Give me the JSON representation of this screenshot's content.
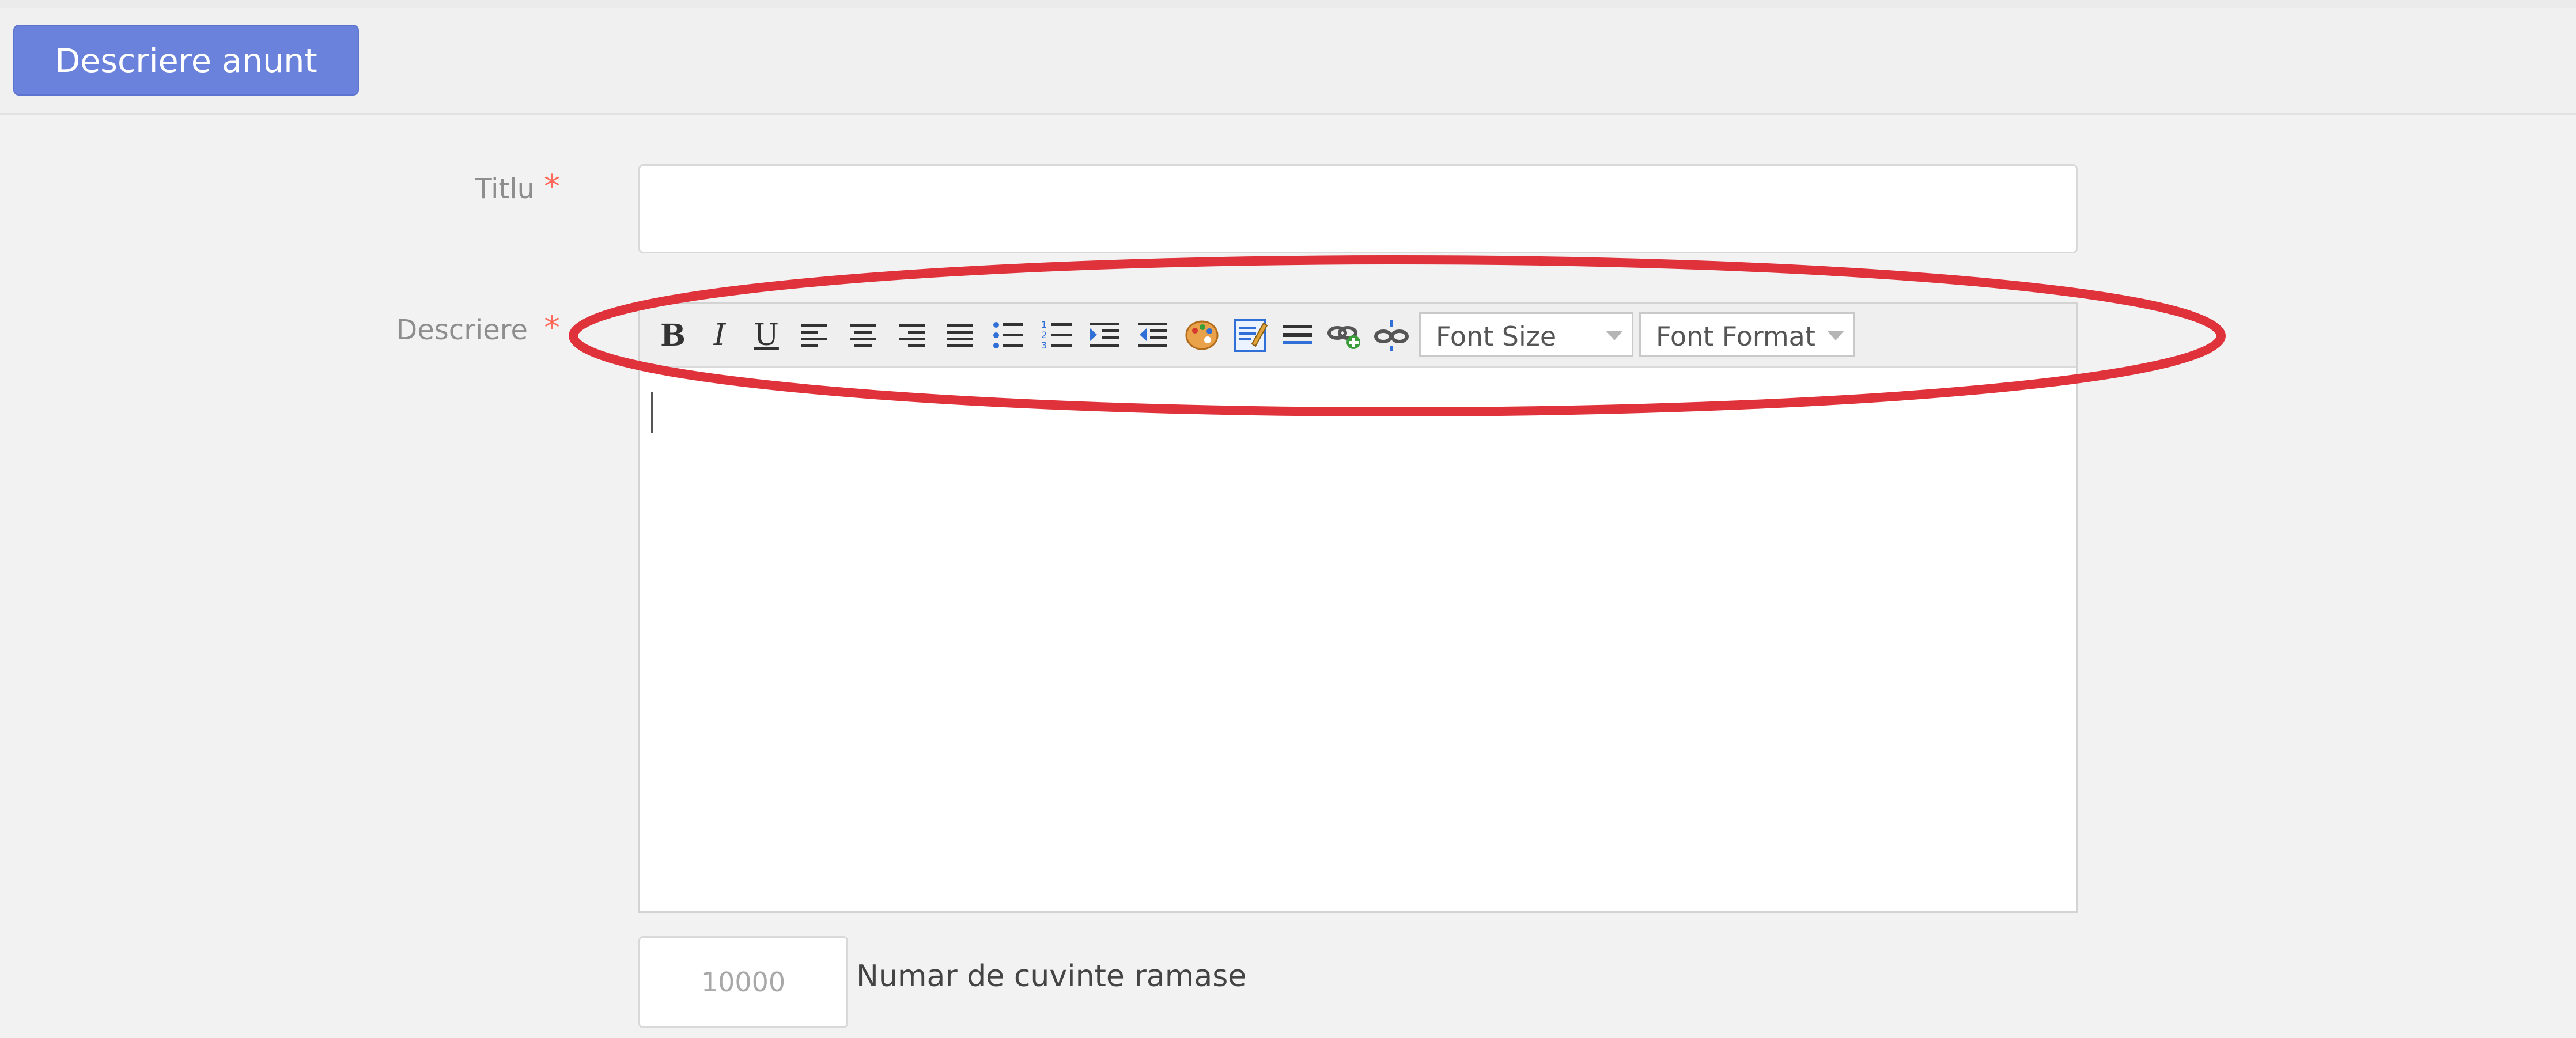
{
  "header": {
    "section_tab": "Descriere anunt"
  },
  "form": {
    "title_label": "Titlu",
    "description_label": "Descriere",
    "required_mark": "*",
    "title_value": "",
    "editor": {
      "toolbar": {
        "buttons": [
          "bold",
          "italic",
          "underline",
          "align-left",
          "align-center",
          "align-right",
          "align-justify",
          "bullet-list",
          "numbered-list",
          "indent",
          "outdent",
          "color",
          "edit-html",
          "horizontal-rule",
          "insert-link",
          "unlink"
        ],
        "font_size_label": "Font Size",
        "font_format_label": "Font Format"
      },
      "content": ""
    },
    "word_counter_value": "10000",
    "word_counter_label": "Numar de cuvinte ramase"
  },
  "annotation": {
    "color": "#e0323a",
    "shape": "ellipse"
  }
}
